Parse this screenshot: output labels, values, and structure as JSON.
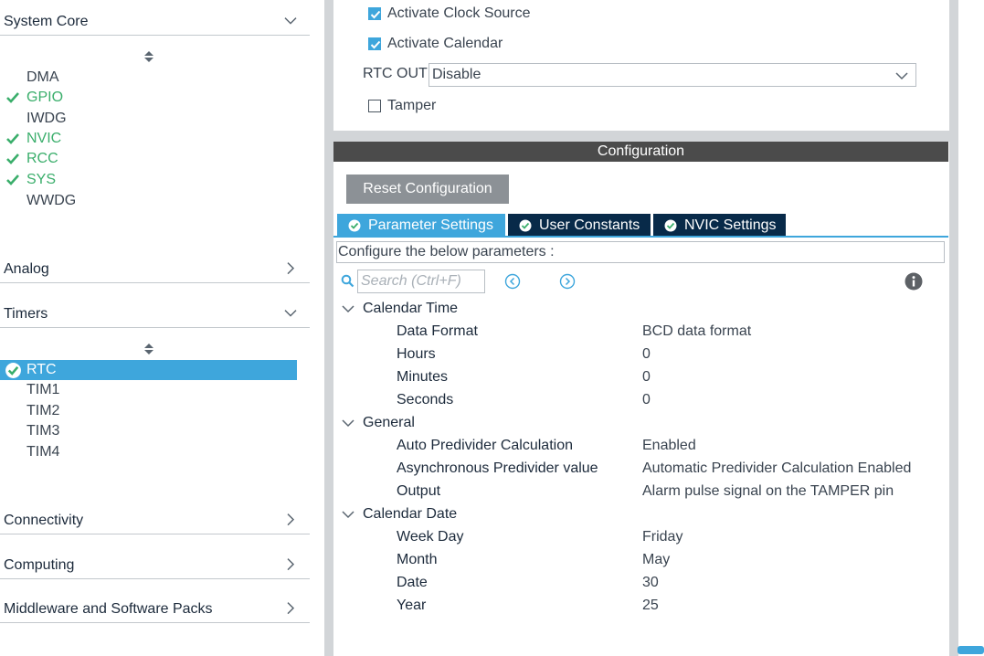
{
  "categories": {
    "system_core": {
      "label": "System Core",
      "items": [
        {
          "label": "DMA",
          "enabled": false
        },
        {
          "label": "GPIO",
          "enabled": true
        },
        {
          "label": "IWDG",
          "enabled": false
        },
        {
          "label": "NVIC",
          "enabled": true
        },
        {
          "label": "RCC",
          "enabled": true
        },
        {
          "label": "SYS",
          "enabled": true
        },
        {
          "label": "WWDG",
          "enabled": false
        }
      ]
    },
    "analog": {
      "label": "Analog"
    },
    "timers": {
      "label": "Timers",
      "items": [
        {
          "label": "RTC",
          "enabled": true,
          "selected": true
        },
        {
          "label": "TIM1",
          "enabled": false
        },
        {
          "label": "TIM2",
          "enabled": false
        },
        {
          "label": "TIM3",
          "enabled": false
        },
        {
          "label": "TIM4",
          "enabled": false
        }
      ]
    },
    "connectivity": {
      "label": "Connectivity"
    },
    "computing": {
      "label": "Computing"
    },
    "middleware": {
      "label": "Middleware and Software Packs"
    }
  },
  "mode": {
    "activate_clock_source": {
      "label": "Activate Clock Source",
      "checked": true
    },
    "activate_calendar": {
      "label": "Activate Calendar",
      "checked": true
    },
    "rtc_out": {
      "label": "RTC OUT",
      "value": "Disable"
    },
    "tamper": {
      "label": "Tamper",
      "checked": false
    }
  },
  "configuration": {
    "title": "Configuration",
    "reset_label": "Reset Configuration",
    "tabs": [
      {
        "label": "Parameter Settings",
        "active": true
      },
      {
        "label": "User Constants",
        "active": false
      },
      {
        "label": "NVIC Settings",
        "active": false
      }
    ],
    "params_description": "Configure the below parameters :",
    "search_placeholder": "Search (Ctrl+F)",
    "groups": [
      {
        "name": "Calendar Time",
        "params": [
          {
            "name": "Data Format",
            "value": "BCD data format"
          },
          {
            "name": "Hours",
            "value": "0"
          },
          {
            "name": "Minutes",
            "value": "0"
          },
          {
            "name": "Seconds",
            "value": "0"
          }
        ]
      },
      {
        "name": "General",
        "params": [
          {
            "name": "Auto Predivider Calculation",
            "value": "Enabled"
          },
          {
            "name": "Asynchronous Predivider value",
            "value": "Automatic Predivider Calculation Enabled"
          },
          {
            "name": "Output",
            "value": "Alarm pulse signal on the TAMPER pin"
          }
        ]
      },
      {
        "name": "Calendar Date",
        "params": [
          {
            "name": "Week Day",
            "value": "Friday"
          },
          {
            "name": "Month",
            "value": "May"
          },
          {
            "name": "Date",
            "value": "30"
          },
          {
            "name": "Year",
            "value": "25"
          }
        ]
      }
    ]
  },
  "colors": {
    "accent": "#3ea6dc",
    "enabled_green": "#3aae6b",
    "tab_dark": "#082a49",
    "config_bar": "#4b4b4b",
    "reset_button": "#8c9196"
  }
}
